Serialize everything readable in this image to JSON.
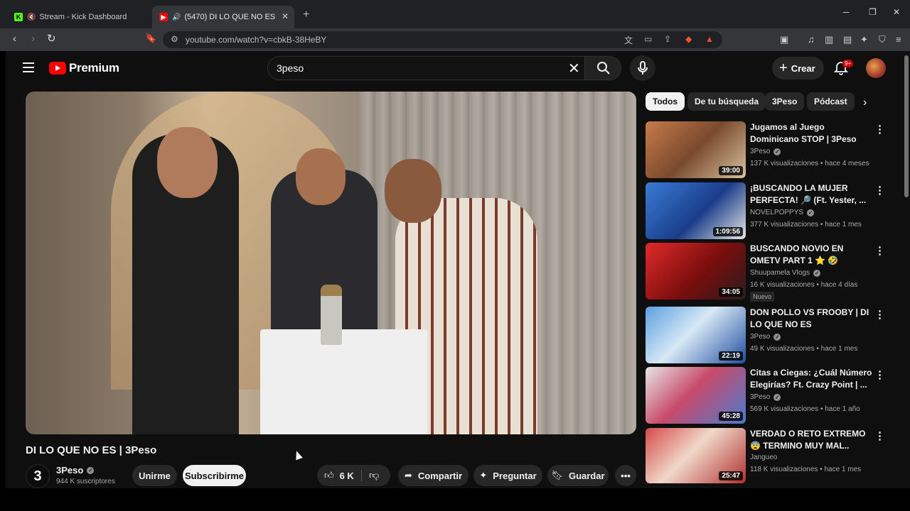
{
  "browser": {
    "tabs": [
      {
        "title": "Stream - Kick Dashboard",
        "muted": true
      },
      {
        "title": "(5470) DI LO QUE NO ES | 3Peso",
        "audio": true,
        "active": true
      }
    ],
    "url": "youtube.com/watch?v=cbkB-38HeBY"
  },
  "youtube": {
    "logo_text": "Premium",
    "search": {
      "value": "3peso"
    },
    "create_label": "Crear",
    "notif_count": "9+",
    "video": {
      "title": "DI LO QUE NO ES | 3Peso",
      "channel": "3Peso",
      "channel_initial": "3",
      "subscribers": "944 K suscriptores",
      "join_label": "Unirme",
      "subscribe_label": "Subscribirme",
      "likes": "6 K",
      "share_label": "Compartir",
      "ask_label": "Preguntar",
      "save_label": "Guardar"
    },
    "chips": [
      "Todos",
      "De tu búsqueda",
      "3Peso",
      "Pódcast"
    ],
    "recommendations": [
      {
        "title": "Jugamos al Juego Dominicano STOP | 3Peso",
        "channel": "3Peso",
        "verified": true,
        "meta": "137 K visualizaciones • hace 4 meses",
        "duration": "39:00"
      },
      {
        "title": "¡BUSCANDO LA MUJER PERFECTA! 🔎 (Ft. Yester, ...",
        "channel": "NOVELPOPPYS",
        "verified": true,
        "meta": "377 K visualizaciones • hace 1 mes",
        "duration": "1:09:56"
      },
      {
        "title": "BUSCANDO NOVIO EN OMETV PART 1 ⭐ 🤣",
        "channel": "Shuupamela Vlogs",
        "verified": true,
        "meta": "16 K visualizaciones • hace 4 días",
        "duration": "34:05",
        "badge": "Nuevo"
      },
      {
        "title": "DON POLLO VS FROOBY | DI LO QUE NO ES",
        "channel": "3Peso",
        "verified": true,
        "meta": "49 K visualizaciones • hace 1 mes",
        "duration": "22:19"
      },
      {
        "title": "Citas a Ciegas: ¿Cuál Número Elegirías? Ft. Crazy Point | ...",
        "channel": "3Peso",
        "verified": true,
        "meta": "569 K visualizaciones • hace 1 año",
        "duration": "45:28"
      },
      {
        "title": "VERDAD O RETO EXTREMO 😨 TERMINO MUY MAL..",
        "channel": "Jangueo",
        "verified": false,
        "meta": "118 K visualizaciones • hace 1 mes",
        "duration": "25:47"
      }
    ]
  }
}
